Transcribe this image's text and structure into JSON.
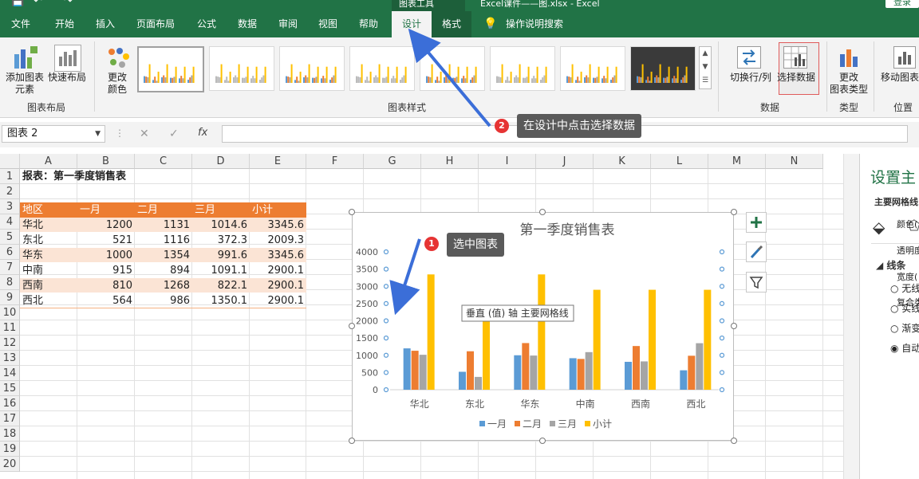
{
  "window": {
    "title": "Excel课件——图.xlsx  -  Excel",
    "context_tab_label": "图表工具",
    "login_label": "登录"
  },
  "tabs": [
    {
      "label": "文件"
    },
    {
      "label": "开始"
    },
    {
      "label": "插入"
    },
    {
      "label": "页面布局"
    },
    {
      "label": "公式"
    },
    {
      "label": "数据"
    },
    {
      "label": "审阅"
    },
    {
      "label": "视图"
    },
    {
      "label": "帮助"
    },
    {
      "label": "设计"
    },
    {
      "label": "格式"
    }
  ],
  "search_tab_label": "操作说明搜索",
  "ribbon": {
    "add_element_label_1": "添加图表",
    "add_element_label_2": "元素",
    "quick_layout_label": "快速布局",
    "change_colors_label_1": "更改",
    "change_colors_label_2": "颜色",
    "group_layout": "图表布局",
    "group_styles": "图表样式",
    "switch_row_col_label": "切换行/列",
    "select_data_label": "选择数据",
    "group_data": "数据",
    "change_type_label_1": "更改",
    "change_type_label_2": "图表类型",
    "group_type": "类型",
    "move_chart_label": "移动图表",
    "group_location": "位置"
  },
  "formula_bar": {
    "name_box": "图表 2",
    "fx": "fx",
    "cancel": "✕",
    "confirm": "✓"
  },
  "sheet": {
    "columns": [
      "A",
      "B",
      "C",
      "D",
      "E",
      "F",
      "G",
      "H",
      "I",
      "J",
      "K",
      "L",
      "M",
      "N"
    ],
    "rows": [
      "1",
      "2",
      "3",
      "4",
      "5",
      "6",
      "7",
      "8",
      "9",
      "10",
      "11",
      "12",
      "13",
      "14",
      "15",
      "16",
      "17",
      "18",
      "19",
      "20"
    ],
    "title": "报表：第一季度销售表",
    "headers": [
      "地区",
      "一月",
      "二月",
      "三月",
      "小计"
    ],
    "data": [
      [
        "华北",
        "1200",
        "1131",
        "1014.6",
        "3345.6"
      ],
      [
        "东北",
        "521",
        "1116",
        "372.3",
        "2009.3"
      ],
      [
        "华东",
        "1000",
        "1354",
        "991.6",
        "3345.6"
      ],
      [
        "中南",
        "915",
        "894",
        "1091.1",
        "2900.1"
      ],
      [
        "西南",
        "810",
        "1268",
        "822.1",
        "2900.1"
      ],
      [
        "西北",
        "564",
        "986",
        "1350.1",
        "2900.1"
      ]
    ],
    "header_color": "#ed7d31",
    "band_color": "#fbe4d5"
  },
  "chart_data": {
    "type": "bar",
    "title": "第一季度销售表",
    "categories": [
      "华北",
      "东北",
      "华东",
      "中南",
      "西南",
      "西北"
    ],
    "series": [
      {
        "name": "一月",
        "values": [
          1200,
          521,
          1000,
          915,
          810,
          564
        ],
        "color": "#5b9bd5"
      },
      {
        "name": "二月",
        "values": [
          1131,
          1116,
          1354,
          894,
          1268,
          986
        ],
        "color": "#ed7d31"
      },
      {
        "name": "三月",
        "values": [
          1014.6,
          372.3,
          991.6,
          1091.1,
          822.1,
          1350.1
        ],
        "color": "#a5a5a5"
      },
      {
        "name": "小计",
        "values": [
          3345.6,
          2009.3,
          3345.6,
          2900.1,
          2900.1,
          2900.1
        ],
        "color": "#ffc000"
      }
    ],
    "ylim": [
      0,
      4000
    ],
    "yticks": [
      "4000",
      "3500",
      "3000",
      "2500",
      "2000",
      "1500",
      "1000",
      "500",
      "0"
    ],
    "legend": "bottom",
    "tooltip": "垂直 (值) 轴 主要网格线"
  },
  "callouts": {
    "step1_number": "1",
    "step1_text": "选中图表",
    "step2_number": "2",
    "step2_text": "在设计中点击选择数据"
  },
  "pane": {
    "title": "设置主",
    "subtitle": "主要网格线",
    "section": "线条",
    "options": [
      "无线",
      "实线",
      "渐变",
      "自动"
    ],
    "props": [
      "颜色(",
      "透明度",
      "宽度(",
      "复合类"
    ]
  }
}
